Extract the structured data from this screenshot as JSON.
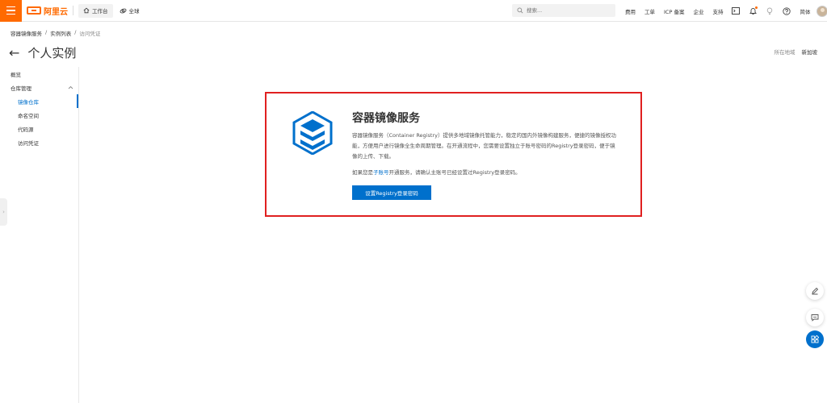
{
  "topbar": {
    "brand": "阿里云",
    "workbench": "工作台",
    "global": "全球",
    "search_placeholder": "搜索...",
    "links": [
      "费用",
      "工单",
      "ICP 备案",
      "企业",
      "支持"
    ],
    "language": "简体"
  },
  "breadcrumb": [
    "容器镜像服务",
    "实例列表",
    "访问凭证"
  ],
  "page": {
    "title": "个人实例",
    "region_label": "所在地域",
    "region_value": "新加坡"
  },
  "sidebar": {
    "overview": "概览",
    "group": "仓库管理",
    "items": [
      "镜像仓库",
      "命名空间",
      "代码源",
      "访问凭证"
    ],
    "active_index": 0
  },
  "card": {
    "title": "容器镜像服务",
    "desc": "容器镜像服务（Container Registry）提供多地域镜像托管能力，稳定的国内外镜像构建服务，便捷的镜像授权功能，方便用户进行镜像全生命周期管理。在开通流程中，您需要设置独立于账号密码的Registry登录密码，便于镜像的上传、下载。",
    "note_prefix": "如果您是",
    "note_link": "子账号",
    "note_suffix": "开通服务，请确认主账号已经设置过Registry登录密码。",
    "button": "设置Registry登录密码"
  },
  "colors": {
    "brand": "#ff6a00",
    "accent": "#0070cc",
    "highlight_border": "#e02020"
  }
}
